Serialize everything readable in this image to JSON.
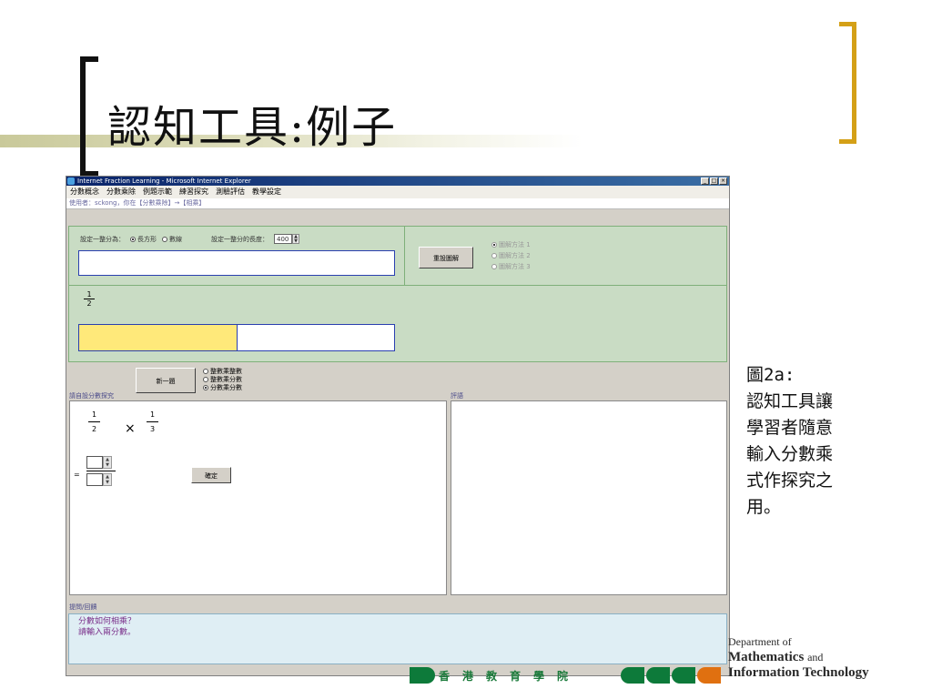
{
  "slide": {
    "title": "認知工具:例子",
    "caption": "圖2a:\n認知工具讓學習者隨意輸入分數乘式作探究之用。",
    "caption_lines": [
      "圖2a:",
      "認知工具讓",
      "學習者隨意",
      "輸入分數乘",
      "式作探究之",
      "用。"
    ],
    "dept_line1": "Department of",
    "dept_line2": "Mathematics",
    "dept_and": "and",
    "dept_line3": "Information Technology",
    "institute": "香港教育學院"
  },
  "window": {
    "title": "Internet Fraction Learning - Microsoft Internet Explorer",
    "menu": [
      "分數概念",
      "分數乘除",
      "例題示範",
      "練習探究",
      "測驗評估",
      "教學設定"
    ],
    "user_line": "使用者：sckong，你在【分數乘除】→【相乘】",
    "settings": {
      "shape_label": "設定一整分為：",
      "opt_rect": "長方形",
      "opt_line": "數線",
      "length_label": "設定一整分的長度：",
      "length_value": "400",
      "reset_label": "重設圖解",
      "methods": [
        "圖解方法 1",
        "圖解方法 2",
        "圖解方法 3"
      ]
    },
    "fraction_display": {
      "numerator": "1",
      "denominator": "2",
      "filled_fraction": 0.5
    },
    "new_question_label": "新一題",
    "modes": [
      "整數乘整數",
      "整數乘分數",
      "分數乘分數"
    ],
    "selected_mode": "分數乘分數",
    "explore_label": "請自設分數探究",
    "comment_label": "評語",
    "expression": {
      "a_num": "1",
      "a_den": "2",
      "operator": "×",
      "b_num": "1",
      "b_den": "3",
      "equals": "="
    },
    "ok_label": "確定",
    "prompt_label": "提問/回饋",
    "prompt_lines": [
      "分數如何相乘？",
      "請輸入兩分數。"
    ]
  },
  "colors": {
    "green_panel": "#c9dcc4",
    "fill_yellow": "#ffe97a",
    "gold_bracket": "#d4a017",
    "titlebar": "#0a246a"
  }
}
